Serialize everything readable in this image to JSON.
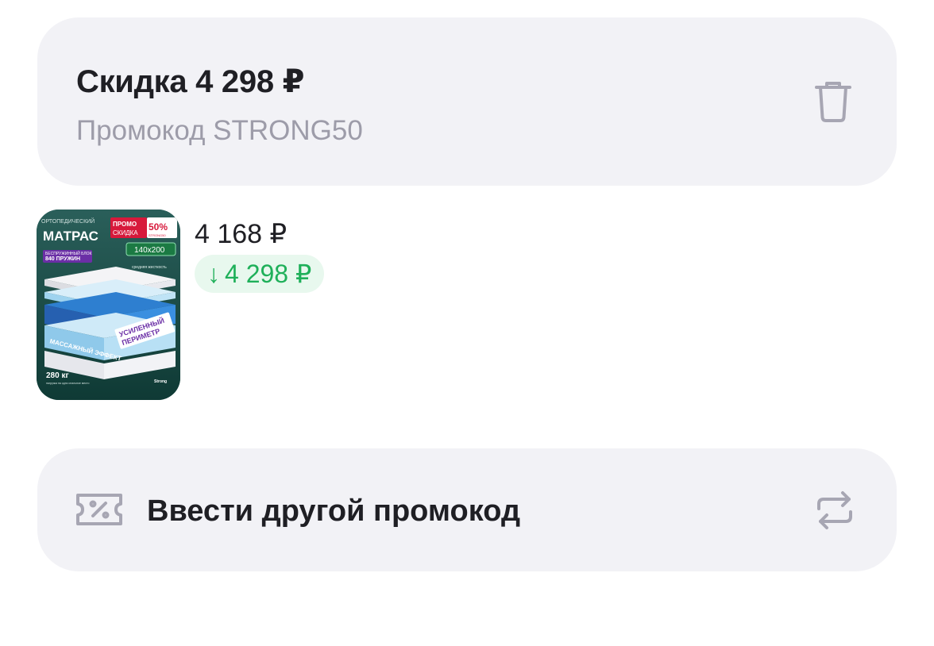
{
  "applied_promo": {
    "title": "Скидка 4 298 ₽",
    "subtitle": "Промокод STRONG50",
    "delete_icon": "trash-icon"
  },
  "product": {
    "price": "4 168 ₽",
    "discount": "4 298 ₽",
    "discount_arrow": "↓",
    "discount_color": "#1fb05a",
    "image": {
      "category": "ОРТОПЕДИЧЕСКИЙ",
      "name": "МАТРАС",
      "promo_label_1": "ПРОМО",
      "promo_label_2": "СКИДКА",
      "promo_percent": "50%",
      "promo_code": "STRONG50",
      "block_type": "БЕСПРУЖИННЫЙ БЛОК",
      "springs": "840 ПРУЖИН",
      "size": "140x200",
      "firmness": "средняя жесткость",
      "perimeter_1": "УСИЛЕННЫЙ",
      "perimeter_2": "ПЕРИМЕТР",
      "massage": "МАССАЖНЫЙ ЭФФЕКТ",
      "weight": "280 кг",
      "weight_note": "нагрузка на одно спальное место",
      "brand": "Strong"
    }
  },
  "other_promo": {
    "label": "Ввести другой промокод",
    "coupon_icon": "coupon-icon",
    "swap_icon": "swap-icon"
  }
}
